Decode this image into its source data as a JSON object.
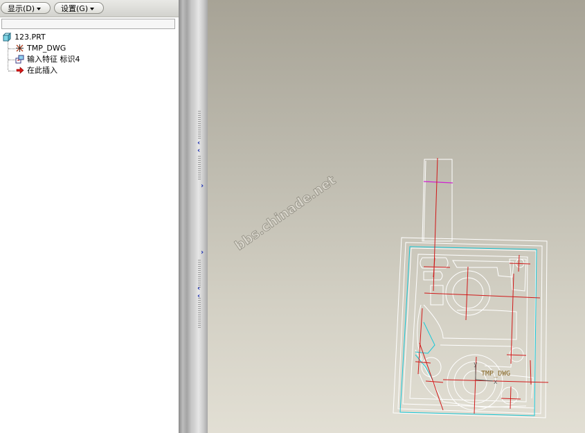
{
  "toolbar": {
    "show_label": "显示(D)",
    "settings_label": "设置(G)"
  },
  "search": {
    "value": ""
  },
  "model_tree": {
    "items": [
      {
        "label": "123.PRT",
        "icon": "part-icon"
      },
      {
        "label": "TMP_DWG",
        "icon": "coordinate-system-icon"
      },
      {
        "label": "输入特征 标识4",
        "icon": "import-feature-icon"
      },
      {
        "label": "在此插入",
        "icon": "insert-here-arrow-icon"
      }
    ]
  },
  "graphics": {
    "watermark": "bbs.chinade.net",
    "csys_label": "TMP_DWG",
    "axis_y": "y",
    "axis_x": "x"
  },
  "colors": {
    "white_edges": "#ffffff",
    "red_centerlines": "#d01818",
    "cyan_outline": "#18c8d8",
    "magenta_line": "#d020d0",
    "csys_text": "#8a6a2a",
    "panel_arrows": "#1b2fb0"
  }
}
